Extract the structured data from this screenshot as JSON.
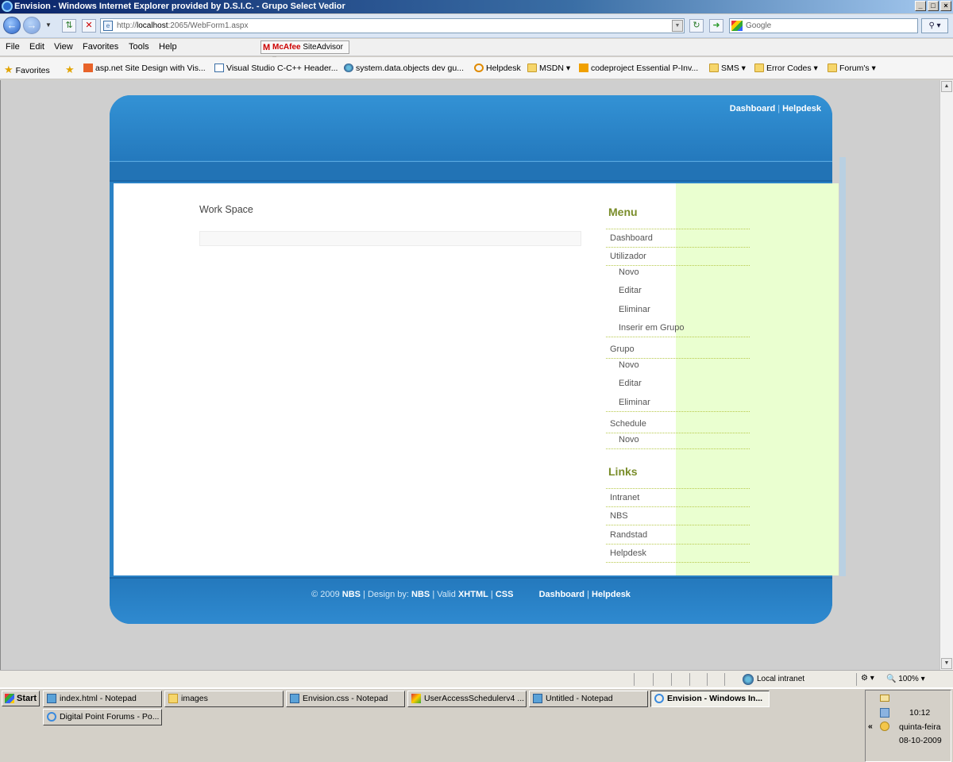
{
  "window": {
    "title": "Envision - Windows Internet Explorer provided by D.S.I.C. - Grupo Select Vedior",
    "buttons": [
      "_",
      "□",
      "×"
    ]
  },
  "browser": {
    "url_prefix": "http://",
    "url_host": "localhost",
    "url_rest": ":2065/WebForm1.aspx",
    "search_placeholder": "Google",
    "menu": [
      "File",
      "Edit",
      "View",
      "Favorites",
      "Tools",
      "Help"
    ],
    "mcafee_brand": "McAfee",
    "mcafee_label": "SiteAdvisor",
    "favorites_label": "Favorites",
    "favorites": [
      {
        "label": "asp.net Site Design with Vis...",
        "icon": "orange-bookmark-icon"
      },
      {
        "label": "Visual Studio C-C++ Header...",
        "icon": "ie-page-icon"
      },
      {
        "label": "system.data.objects dev gu...",
        "icon": "globe-icon"
      },
      {
        "label": "Helpdesk",
        "icon": "ring-icon"
      },
      {
        "label": "MSDN",
        "icon": "folder-icon",
        "dropdown": true
      },
      {
        "label": "codeproject Essential P-Inv...",
        "icon": "codeproject-icon"
      },
      {
        "label": "SMS",
        "icon": "folder-icon",
        "dropdown": true
      },
      {
        "label": "Error Codes",
        "icon": "folder-icon",
        "dropdown": true
      },
      {
        "label": "Forum's",
        "icon": "folder-icon",
        "dropdown": true
      }
    ]
  },
  "site": {
    "header_links": [
      "Dashboard",
      "Helpdesk"
    ],
    "workspace_title": "Work Space",
    "menu_heading": "Menu",
    "menu_items": [
      {
        "label": "Dashboard",
        "level": 0
      },
      {
        "label": "Utilizador",
        "level": 0
      },
      {
        "label": "Novo",
        "level": 1
      },
      {
        "label": "Editar",
        "level": 1
      },
      {
        "label": "Eliminar",
        "level": 1
      },
      {
        "label": "Inserir em Grupo",
        "level": 1
      },
      {
        "label": "Grupo",
        "level": 0
      },
      {
        "label": "Novo",
        "level": 1
      },
      {
        "label": "Editar",
        "level": 1
      },
      {
        "label": "Eliminar",
        "level": 1
      },
      {
        "label": "Schedule",
        "level": 0
      },
      {
        "label": "Novo",
        "level": 1
      }
    ],
    "links_heading": "Links",
    "links": [
      "Intranet",
      "NBS",
      "Randstad",
      "Helpdesk"
    ],
    "footer": {
      "copyright": "© 2009",
      "nbs": "NBS",
      "design_by": "| Design by:",
      "nbs2": "NBS",
      "valid": "| Valid",
      "xhtml": "XHTML",
      "sep": "|",
      "css": "CSS",
      "link1": "Dashboard",
      "link2": "Helpdesk"
    },
    "colors": {
      "brand_blue": "#2a82c6",
      "menu_green": "#7a8d2a",
      "sidebar_bg": "#eaffd0"
    }
  },
  "statusbar": {
    "zone": "Local intranet",
    "zoom": "100%"
  },
  "taskbar": {
    "start": "Start",
    "tasks": [
      {
        "label": "index.html - Notepad",
        "icon": "notepad-icon"
      },
      {
        "label": "images",
        "icon": "folder-icon"
      },
      {
        "label": "Envision.css - Notepad",
        "icon": "notepad-icon"
      },
      {
        "label": "UserAccessSchedulerv4 ...",
        "icon": "visual-studio-icon"
      },
      {
        "label": "Untitled - Notepad",
        "icon": "notepad-icon"
      },
      {
        "label": "Envision - Windows In...",
        "icon": "ie-icon",
        "active": true
      },
      {
        "label": "Digital Point Forums - Po...",
        "icon": "ie-icon"
      }
    ],
    "clock": {
      "time": "10:12",
      "day": "quinta-feira",
      "date": "08-10-2009"
    }
  }
}
